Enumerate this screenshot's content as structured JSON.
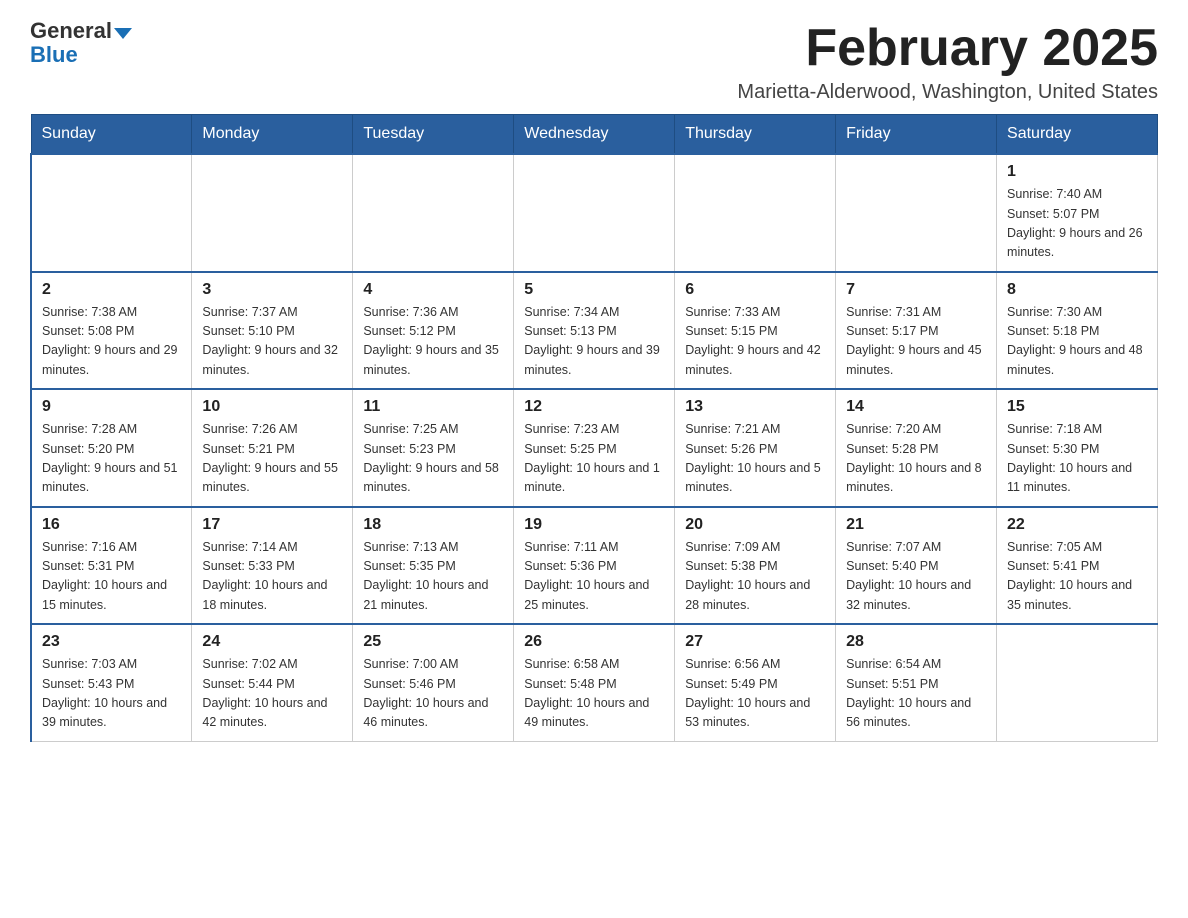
{
  "logo": {
    "name_black": "General",
    "name_blue": "Blue",
    "arrow_symbol": "▼"
  },
  "header": {
    "month_year": "February 2025",
    "location": "Marietta-Alderwood, Washington, United States"
  },
  "days_of_week": [
    "Sunday",
    "Monday",
    "Tuesday",
    "Wednesday",
    "Thursday",
    "Friday",
    "Saturday"
  ],
  "weeks": [
    [
      {
        "day": "",
        "sunrise": "",
        "sunset": "",
        "daylight": ""
      },
      {
        "day": "",
        "sunrise": "",
        "sunset": "",
        "daylight": ""
      },
      {
        "day": "",
        "sunrise": "",
        "sunset": "",
        "daylight": ""
      },
      {
        "day": "",
        "sunrise": "",
        "sunset": "",
        "daylight": ""
      },
      {
        "day": "",
        "sunrise": "",
        "sunset": "",
        "daylight": ""
      },
      {
        "day": "",
        "sunrise": "",
        "sunset": "",
        "daylight": ""
      },
      {
        "day": "1",
        "sunrise": "Sunrise: 7:40 AM",
        "sunset": "Sunset: 5:07 PM",
        "daylight": "Daylight: 9 hours and 26 minutes."
      }
    ],
    [
      {
        "day": "2",
        "sunrise": "Sunrise: 7:38 AM",
        "sunset": "Sunset: 5:08 PM",
        "daylight": "Daylight: 9 hours and 29 minutes."
      },
      {
        "day": "3",
        "sunrise": "Sunrise: 7:37 AM",
        "sunset": "Sunset: 5:10 PM",
        "daylight": "Daylight: 9 hours and 32 minutes."
      },
      {
        "day": "4",
        "sunrise": "Sunrise: 7:36 AM",
        "sunset": "Sunset: 5:12 PM",
        "daylight": "Daylight: 9 hours and 35 minutes."
      },
      {
        "day": "5",
        "sunrise": "Sunrise: 7:34 AM",
        "sunset": "Sunset: 5:13 PM",
        "daylight": "Daylight: 9 hours and 39 minutes."
      },
      {
        "day": "6",
        "sunrise": "Sunrise: 7:33 AM",
        "sunset": "Sunset: 5:15 PM",
        "daylight": "Daylight: 9 hours and 42 minutes."
      },
      {
        "day": "7",
        "sunrise": "Sunrise: 7:31 AM",
        "sunset": "Sunset: 5:17 PM",
        "daylight": "Daylight: 9 hours and 45 minutes."
      },
      {
        "day": "8",
        "sunrise": "Sunrise: 7:30 AM",
        "sunset": "Sunset: 5:18 PM",
        "daylight": "Daylight: 9 hours and 48 minutes."
      }
    ],
    [
      {
        "day": "9",
        "sunrise": "Sunrise: 7:28 AM",
        "sunset": "Sunset: 5:20 PM",
        "daylight": "Daylight: 9 hours and 51 minutes."
      },
      {
        "day": "10",
        "sunrise": "Sunrise: 7:26 AM",
        "sunset": "Sunset: 5:21 PM",
        "daylight": "Daylight: 9 hours and 55 minutes."
      },
      {
        "day": "11",
        "sunrise": "Sunrise: 7:25 AM",
        "sunset": "Sunset: 5:23 PM",
        "daylight": "Daylight: 9 hours and 58 minutes."
      },
      {
        "day": "12",
        "sunrise": "Sunrise: 7:23 AM",
        "sunset": "Sunset: 5:25 PM",
        "daylight": "Daylight: 10 hours and 1 minute."
      },
      {
        "day": "13",
        "sunrise": "Sunrise: 7:21 AM",
        "sunset": "Sunset: 5:26 PM",
        "daylight": "Daylight: 10 hours and 5 minutes."
      },
      {
        "day": "14",
        "sunrise": "Sunrise: 7:20 AM",
        "sunset": "Sunset: 5:28 PM",
        "daylight": "Daylight: 10 hours and 8 minutes."
      },
      {
        "day": "15",
        "sunrise": "Sunrise: 7:18 AM",
        "sunset": "Sunset: 5:30 PM",
        "daylight": "Daylight: 10 hours and 11 minutes."
      }
    ],
    [
      {
        "day": "16",
        "sunrise": "Sunrise: 7:16 AM",
        "sunset": "Sunset: 5:31 PM",
        "daylight": "Daylight: 10 hours and 15 minutes."
      },
      {
        "day": "17",
        "sunrise": "Sunrise: 7:14 AM",
        "sunset": "Sunset: 5:33 PM",
        "daylight": "Daylight: 10 hours and 18 minutes."
      },
      {
        "day": "18",
        "sunrise": "Sunrise: 7:13 AM",
        "sunset": "Sunset: 5:35 PM",
        "daylight": "Daylight: 10 hours and 21 minutes."
      },
      {
        "day": "19",
        "sunrise": "Sunrise: 7:11 AM",
        "sunset": "Sunset: 5:36 PM",
        "daylight": "Daylight: 10 hours and 25 minutes."
      },
      {
        "day": "20",
        "sunrise": "Sunrise: 7:09 AM",
        "sunset": "Sunset: 5:38 PM",
        "daylight": "Daylight: 10 hours and 28 minutes."
      },
      {
        "day": "21",
        "sunrise": "Sunrise: 7:07 AM",
        "sunset": "Sunset: 5:40 PM",
        "daylight": "Daylight: 10 hours and 32 minutes."
      },
      {
        "day": "22",
        "sunrise": "Sunrise: 7:05 AM",
        "sunset": "Sunset: 5:41 PM",
        "daylight": "Daylight: 10 hours and 35 minutes."
      }
    ],
    [
      {
        "day": "23",
        "sunrise": "Sunrise: 7:03 AM",
        "sunset": "Sunset: 5:43 PM",
        "daylight": "Daylight: 10 hours and 39 minutes."
      },
      {
        "day": "24",
        "sunrise": "Sunrise: 7:02 AM",
        "sunset": "Sunset: 5:44 PM",
        "daylight": "Daylight: 10 hours and 42 minutes."
      },
      {
        "day": "25",
        "sunrise": "Sunrise: 7:00 AM",
        "sunset": "Sunset: 5:46 PM",
        "daylight": "Daylight: 10 hours and 46 minutes."
      },
      {
        "day": "26",
        "sunrise": "Sunrise: 6:58 AM",
        "sunset": "Sunset: 5:48 PM",
        "daylight": "Daylight: 10 hours and 49 minutes."
      },
      {
        "day": "27",
        "sunrise": "Sunrise: 6:56 AM",
        "sunset": "Sunset: 5:49 PM",
        "daylight": "Daylight: 10 hours and 53 minutes."
      },
      {
        "day": "28",
        "sunrise": "Sunrise: 6:54 AM",
        "sunset": "Sunset: 5:51 PM",
        "daylight": "Daylight: 10 hours and 56 minutes."
      },
      {
        "day": "",
        "sunrise": "",
        "sunset": "",
        "daylight": ""
      }
    ]
  ]
}
